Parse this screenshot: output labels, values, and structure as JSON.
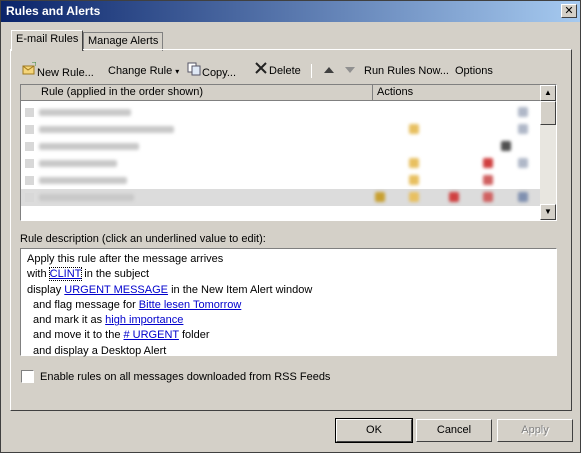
{
  "window": {
    "title": "Rules and Alerts",
    "close_glyph": "✕"
  },
  "tabs": [
    {
      "label": "E-mail Rules"
    },
    {
      "label": "Manage Alerts"
    }
  ],
  "toolbar": {
    "new_rule": "New Rule...",
    "change_rule": "Change Rule",
    "copy": "Copy...",
    "delete": "Delete",
    "run_rules_now": "Run Rules Now...",
    "options": "Options",
    "icons": {
      "new_rule": "new-rule-icon",
      "copy": "copy-icon",
      "delete": "delete-x-icon",
      "move_up": "arrow-up-icon",
      "move_down": "arrow-down-icon"
    }
  },
  "rules_list": {
    "col_rule": "Rule (applied in the order shown)",
    "col_actions": "Actions",
    "row_count": 6,
    "selected_row": 5
  },
  "description": {
    "label": "Rule description (click an underlined value to edit):",
    "line1": "Apply this rule after the message arrives",
    "line2_pre": "with ",
    "line2_link": "CLINT",
    "line2_post": " in the subject",
    "line3_pre": "display ",
    "line3_link": "URGENT MESSAGE",
    "line3_post": " in the New Item Alert window",
    "line4_pre": "and flag message for ",
    "line4_link": "Bitte lesen Tomorrow",
    "line5_pre": "and mark it as ",
    "line5_link": "high importance",
    "line6_pre": "and move it to the ",
    "line6_link": "# URGENT",
    "line6_post": " folder",
    "line7": "and display a Desktop Alert"
  },
  "rss_checkbox": {
    "label": "Enable rules on all messages downloaded from RSS Feeds",
    "checked": false
  },
  "buttons": {
    "ok": "OK",
    "cancel": "Cancel",
    "apply": "Apply"
  },
  "colors": {
    "link": "#0000cc",
    "dialog_bg": "#d4d0c8",
    "title_start": "#0a246a",
    "title_end": "#a6caf0"
  }
}
